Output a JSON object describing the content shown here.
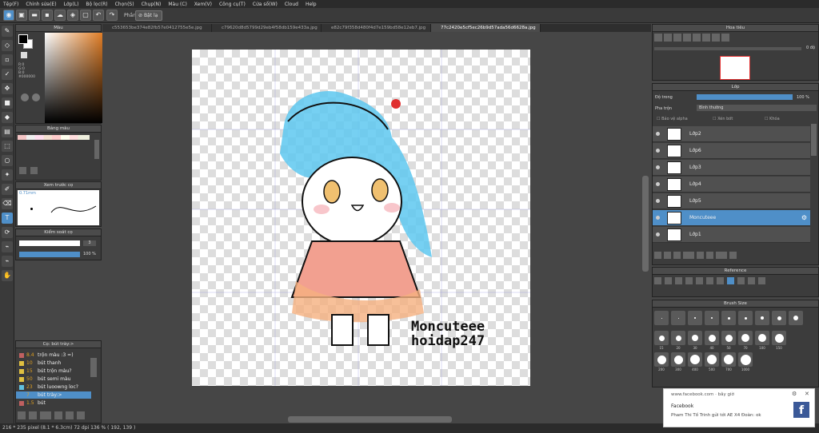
{
  "menu": [
    "Tệp(F)",
    "Chỉnh sửa(E)",
    "Lớp(L)",
    "Bộ lọc(R)",
    "Chọn(S)",
    "Chụp(N)",
    "Màu (C)",
    "Xem(V)",
    "Công cụ(T)",
    "Cửa số(W)",
    "Cloud",
    "Help"
  ],
  "toolbar": {
    "snap_label": "Phần",
    "snap_toggle": "Bật lạ"
  },
  "tabs": [
    "c553653be374e82fb57e0412755e5e.jpg",
    "c79620d8d5799d29eb4f58db159e433a.jpg",
    "e82c79f358d480f4d7e159bd58e12eb7.jpg",
    "77c2420e5cf5ec26b9d57ada56d6628a.jpg"
  ],
  "color_panel": {
    "title": "Màu",
    "r": "R:0",
    "g": "G:0",
    "b": "B:0",
    "hex": "#000000"
  },
  "palette_panel": {
    "title": "Bảng màu"
  },
  "brush_preview": {
    "title": "Xem trước cọ",
    "size": "0.71mm"
  },
  "brush_control": {
    "title": "Kiểm soát cọ",
    "size_value": "3",
    "opacity_value": "100 %"
  },
  "brush_list": {
    "title": "Cọ: bút trày:>",
    "items": [
      {
        "size": "8.4",
        "name": "trộn màu :3 =)",
        "color": "#c06060"
      },
      {
        "size": "10",
        "name": "bút thanh",
        "color": "#e0c040"
      },
      {
        "size": "15",
        "name": "bút trộn màu?",
        "color": "#e0c040"
      },
      {
        "size": "50",
        "name": "bút semi màu",
        "color": "#e0c040"
      },
      {
        "size": "23",
        "name": "bút luoowng loc?",
        "color": "#60c0e0"
      },
      {
        "size": "7",
        "name": "bút trày:>",
        "color": "#4f8fc8"
      },
      {
        "size": "1.5",
        "name": "bút",
        "color": "#c06060"
      }
    ]
  },
  "navigator": {
    "title": "Hoa tiêu",
    "zoom": "0 độ"
  },
  "layers_panel": {
    "title": "Lớp",
    "opacity_label": "Độ trong",
    "opacity_value": "100 %",
    "blend_label": "Pha trộn",
    "blend_value": "Bình thường",
    "protect_alpha": "Bảo vệ alpha",
    "clipping": "Xén bớt",
    "lock": "Khóa",
    "layers": [
      {
        "name": "Lớp2"
      },
      {
        "name": "Lớp6"
      },
      {
        "name": "Lớp3"
      },
      {
        "name": "Lớp4"
      },
      {
        "name": "Lớp5"
      },
      {
        "name": "Moncuteee",
        "selected": true
      },
      {
        "name": "Lớp1"
      }
    ]
  },
  "reference_panel": {
    "title": "Reference"
  },
  "brush_size_panel": {
    "title": "Brush Size",
    "labels_row1": [
      "",
      "",
      "",
      "",
      "",
      "",
      "",
      "",
      ""
    ],
    "labels_row2": [
      "15",
      "20",
      "30",
      "40",
      "50",
      "70",
      "100",
      "150"
    ],
    "labels_row3": [
      "200",
      "300",
      "400",
      "500",
      "700",
      "1000"
    ]
  },
  "artwork": {
    "text_line1": "Moncuteee",
    "text_line2": "hoidap247"
  },
  "status": "216 * 235 pixel  (8.1 * 6.3cm)  72 dpi  136 %  ( 192, 139 )",
  "notification": {
    "source": "www.facebook.com · bây giờ",
    "app": "Facebook",
    "message": "Pham Thi Tố Trinh gửi tới AE X4 Đoàn: ok"
  },
  "colors": {
    "accent": "#4f8fc8",
    "panel": "#3c3c3c",
    "hair": "#5ec8f0",
    "dress": "#f2a090"
  }
}
